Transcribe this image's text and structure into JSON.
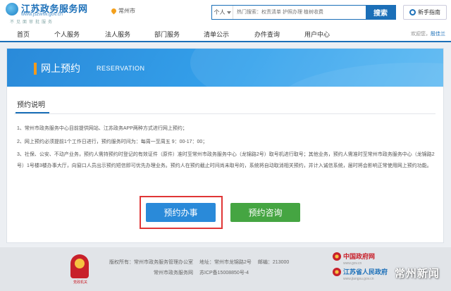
{
  "header": {
    "logo_title": "江苏政务服务网",
    "logo_url": "www.jszwfw.gov.cn",
    "logo_sub": "不见面审批服务",
    "city": "常州市",
    "search_scope": "个人",
    "search_placeholder": "热门搜索：权责清单 护照办理 植树收费",
    "search_button": "搜索",
    "guide_label": "新手指南"
  },
  "nav": {
    "items": [
      "首页",
      "个人服务",
      "法人服务",
      "部门服务",
      "清单公示",
      "办件查询",
      "用户中心"
    ],
    "welcome": "欢迎您，",
    "user": "殷佳兰"
  },
  "banner": {
    "title": "网上预约",
    "title_en": "RESERVATION"
  },
  "section": {
    "title": "预约说明",
    "notes": [
      "1、常州市政务服务中心目前提供网站、江苏政务APP两种方式进行网上预约；",
      "2、网上预约必须提前1个工作日进行，预约服务时间为：每周一至周五 9：00-17：00；",
      "3、社保、公安、不动产业务，预约人需持预约时登记的有效证件（原件）准时至常州市政务服务中心（龙锦路2号）取号机进行取号；其他业务，预约人需准时至常州市政务服务中心（龙锦路2号）1号楼3楼办事大厅，向窗口人员出示预约短信即可优先办理业务。预约人在预约截止时间尚未取号的，系统将自动取消相关预约，并计入诚信系统，届时将会影响正常使用网上预约功能。"
    ]
  },
  "actions": {
    "book": "预约办事",
    "consult": "预约咨询"
  },
  "footer": {
    "copyright": "版权所有：常州市政务服务管理办公室",
    "address": "地址：常州市龙锦路2号",
    "postcode": "邮编：213000",
    "site": "常州市政务服务网",
    "icp": "苏ICP备15008850号-4",
    "badge_text": "党政机关",
    "gov1": "中国政府网",
    "gov1_url": "www.gov.cn",
    "gov2": "江苏省人民政府",
    "gov2_url": "www.jiangsu.gov.cn",
    "watermark": "常州新闻"
  },
  "colors": {
    "brand_blue": "#1b6fb8",
    "book_button": "#2a8ad9",
    "consult_button": "#45a542",
    "highlight_red": "#e03636"
  }
}
